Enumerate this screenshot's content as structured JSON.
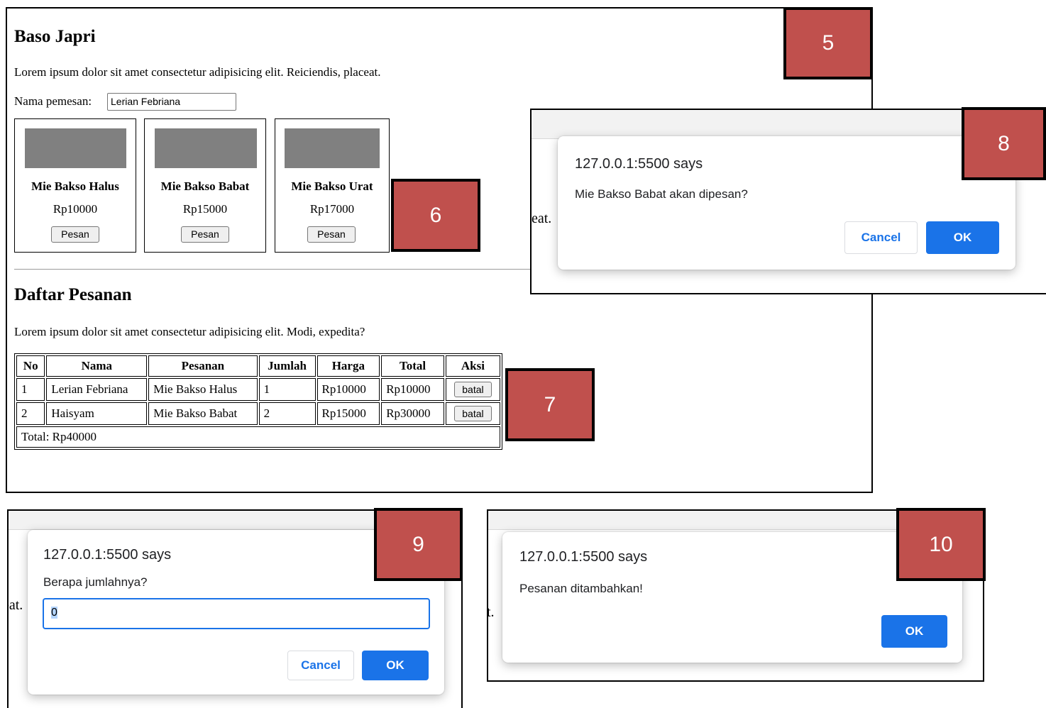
{
  "badges": {
    "b5": "5",
    "b6": "6",
    "b7": "7",
    "b8": "8",
    "b9": "9",
    "b10": "10"
  },
  "app": {
    "title": "Baso Japri",
    "intro": "Lorem ipsum dolor sit amet consectetur adipisicing elit. Reiciendis, placeat.",
    "name_label": "Nama pemesan:",
    "name_value": "Lerian Febriana",
    "menu": [
      {
        "name": "Mie Bakso Halus",
        "price": "Rp10000",
        "button": "Pesan"
      },
      {
        "name": "Mie Bakso Babat",
        "price": "Rp15000",
        "button": "Pesan"
      },
      {
        "name": "Mie Bakso Urat",
        "price": "Rp17000",
        "button": "Pesan"
      }
    ],
    "orders_title": "Daftar Pesanan",
    "orders_intro": "Lorem ipsum dolor sit amet consectetur adipisicing elit. Modi, expedita?",
    "table": {
      "headers": [
        "No",
        "Nama",
        "Pesanan",
        "Jumlah",
        "Harga",
        "Total",
        "Aksi"
      ],
      "rows": [
        [
          "1",
          "Lerian Febriana",
          "Mie Bakso Halus",
          "1",
          "Rp10000",
          "Rp10000",
          "batal"
        ],
        [
          "2",
          "Haisyam",
          "Mie Bakso Babat",
          "2",
          "Rp15000",
          "Rp30000",
          "batal"
        ]
      ],
      "total": "Total: Rp40000"
    }
  },
  "dialog_confirm": {
    "origin": "127.0.0.1:5500 says",
    "message": "Mie Bakso Babat akan dipesan?",
    "cancel": "Cancel",
    "ok": "OK",
    "bg_fragment": "eat."
  },
  "dialog_prompt": {
    "origin": "127.0.0.1:5500 says",
    "message": "Berapa jumlahnya?",
    "value": "0",
    "cancel": "Cancel",
    "ok": "OK",
    "bg_fragment": "eat."
  },
  "dialog_alert": {
    "origin": "127.0.0.1:5500 says",
    "message": "Pesanan ditambahkan!",
    "ok": "OK",
    "bg_fragment": "t."
  },
  "colors": {
    "badge": "#c0504d",
    "dialog_button": "#1a73e8",
    "image_placeholder": "#808080"
  }
}
